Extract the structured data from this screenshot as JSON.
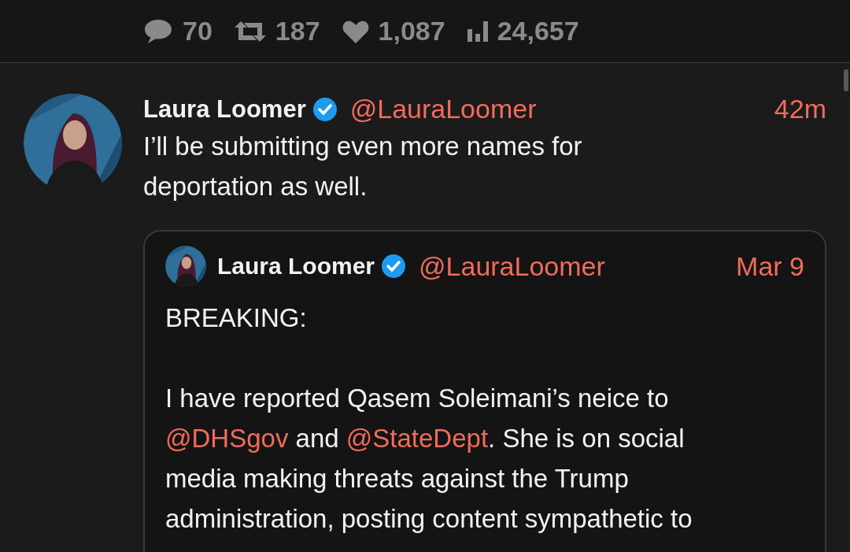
{
  "stats": [
    {
      "kind": "replies",
      "count": "70"
    },
    {
      "kind": "retweets",
      "count": "187"
    },
    {
      "kind": "likes",
      "count": "1,087"
    },
    {
      "kind": "views",
      "count": "24,657"
    }
  ],
  "tweet": {
    "name": "Laura Loomer",
    "verified": true,
    "handle": "@LauraLoomer",
    "time": "42m",
    "lines": [
      "I’ll be submitting even more names for",
      "deportation as well."
    ],
    "quote": {
      "name": "Laura Loomer",
      "verified": true,
      "handle": "@LauraLoomer",
      "time": "Mar 9",
      "title": "BREAKING:",
      "lines": [
        [
          {
            "kind": "text",
            "text": "I have reported Qasem Soleimani’s neice to"
          }
        ],
        [
          {
            "kind": "mention",
            "text": "@DHSgov"
          },
          {
            "kind": "text",
            "text": " and "
          },
          {
            "kind": "mention",
            "text": "@StateDept"
          },
          {
            "kind": "text",
            "text": ". She is on social"
          }
        ],
        [
          {
            "kind": "text",
            "text": "media making threats against the Trump"
          }
        ],
        [
          {
            "kind": "text",
            "text": "administration, posting content sympathetic to"
          }
        ]
      ]
    }
  }
}
